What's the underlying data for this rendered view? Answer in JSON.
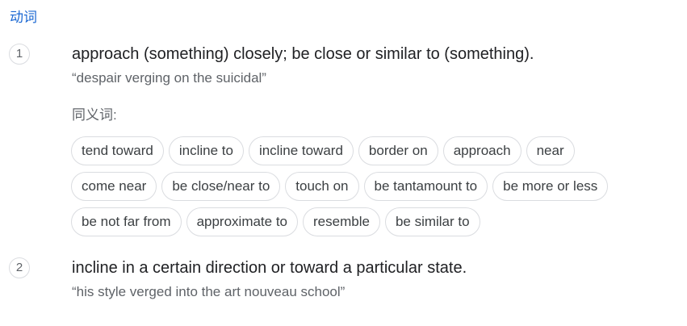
{
  "part_of_speech": "动词",
  "senses": [
    {
      "number": "1",
      "definition": "approach (something) closely; be close or similar to (something).",
      "example": "“despair verging on the suicidal”"
    },
    {
      "number": "2",
      "definition": "incline in a certain direction or toward a particular state.",
      "example": "“his style verged into the art nouveau school”"
    }
  ],
  "synonyms": {
    "heading": "同义词:",
    "items": [
      "tend toward",
      "incline to",
      "incline toward",
      "border on",
      "approach",
      "near",
      "come near",
      "be close/near to",
      "touch on",
      "be tantamount to",
      "be more or less",
      "be not far from",
      "approximate to",
      "resemble",
      "be similar to"
    ]
  }
}
